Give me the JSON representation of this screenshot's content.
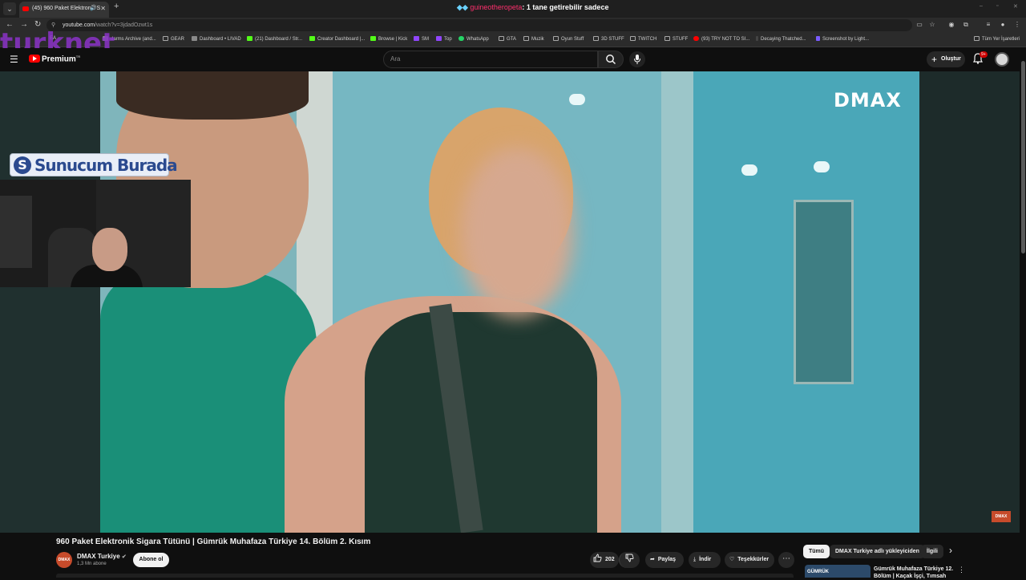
{
  "browser": {
    "tab_title": "(45) 960 Paket Elektronik S",
    "url_host": "youtube.com",
    "url_path": "/watch?v=3jdadOzwt1s",
    "overlay_chat_user": "guineotheropeta",
    "overlay_chat_text": ": 1 tane getirebilir sadece",
    "bookmarks": [
      "EA",
      "darms Archive (and...",
      "GEAR",
      "Dashboard • LIVAD",
      "(21) Dashboard / Str...",
      "Creator Dashboard |...",
      "Browse | Kick",
      "SM",
      "Top",
      "WhatsApp",
      "GTA",
      "Muzik",
      "Oyun Stuff",
      "3D STUFF",
      "TWITCH",
      "STUFF",
      "(93) TRY NOT TO SI...",
      "Decaying Thatched...",
      "Screenshot by Light...",
      "Tüm Yer İşaretleri"
    ],
    "watermark_text": "turknet"
  },
  "youtube": {
    "premium_label": "Premium",
    "premium_region": "TR",
    "search_placeholder": "Ara",
    "create_label": "Oluştur",
    "notification_count": "9+"
  },
  "player": {
    "channel_bug": "DMAX",
    "sponsor_text": "Sunucum Burada",
    "corner_logo": "DMAX"
  },
  "video": {
    "title": "960 Paket Elektronik Sigara Tütünü | Gümrük Muhafaza Türkiye 14. Bölüm 2. Kısım",
    "channel_name": "DMAX Turkiye",
    "channel_avatar_text": "DMAX",
    "subscribers": "1,3 Mn abone",
    "subscribe_label": "Abone ol",
    "likes": "202",
    "share_label": "Paylaş",
    "download_label": "İndir",
    "thanks_label": "Teşekkürler"
  },
  "sidebar": {
    "chips": [
      "Tümü",
      "DMAX Turkiye adlı yükleyiciden",
      "İlgili"
    ],
    "rec_title": "Gümrük Muhafaza Türkiye 12. Bölüm | Kaçak İşçi, Tımsah",
    "rec_thumb_text": "GÜMRÜK"
  },
  "icons": {
    "menu": "hamburger-icon",
    "search": "search-icon",
    "mic": "mic-icon",
    "bell": "bell-icon",
    "like": "thumbs-up-icon",
    "dislike": "thumbs-down-icon",
    "share": "share-icon",
    "download": "download-icon",
    "thanks": "thanks-icon"
  },
  "colors": {
    "youtube_red": "#ff0000",
    "background": "#0f0f0f",
    "pill": "#272727",
    "watermark": "#8b33c8"
  }
}
